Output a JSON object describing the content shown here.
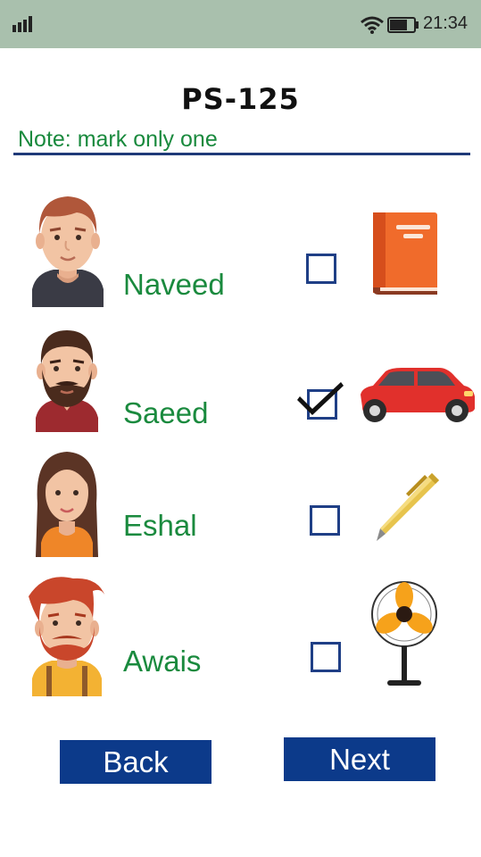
{
  "status_bar": {
    "time": "21:34"
  },
  "page": {
    "title": "PS-125",
    "note": "Note: mark only one"
  },
  "rows": [
    {
      "name": "Naveed",
      "item": "book-icon",
      "checked": false
    },
    {
      "name": "Saeed",
      "item": "car-icon",
      "checked": true
    },
    {
      "name": "Eshal",
      "item": "pen-icon",
      "checked": false
    },
    {
      "name": "Awais",
      "item": "fan-icon",
      "checked": false
    }
  ],
  "buttons": {
    "back": "Back",
    "next": "Next"
  },
  "colors": {
    "status_bar": "#a9c0ad",
    "accent_green": "#1a8a3e",
    "button_blue": "#0c3a8a",
    "rule_blue": "#1f3a78"
  }
}
